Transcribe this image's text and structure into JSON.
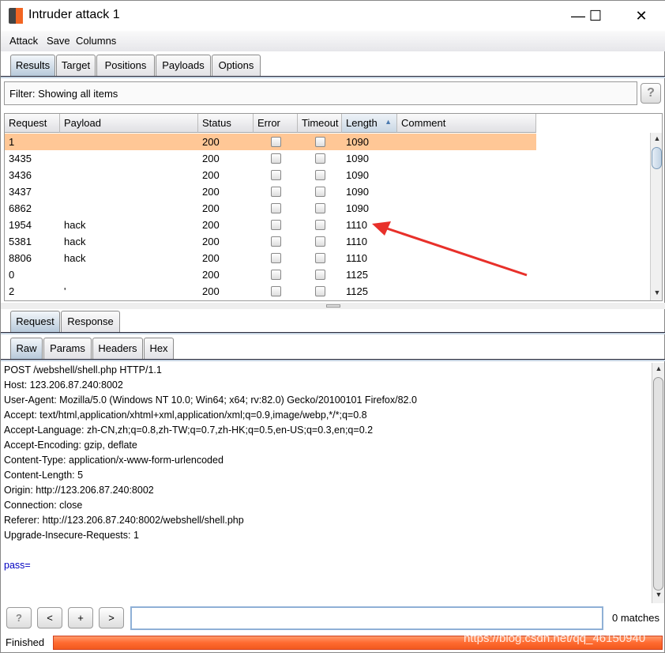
{
  "window": {
    "title": "Intruder attack 1",
    "minimize": "—",
    "maximize": "☐",
    "close": "✕"
  },
  "menu": [
    "Attack",
    "Save",
    "Columns"
  ],
  "tabs": [
    "Results",
    "Target",
    "Positions",
    "Payloads",
    "Options"
  ],
  "filter": {
    "text": "Filter: Showing all items",
    "help": "?"
  },
  "table": {
    "columns": [
      "Request",
      "Payload",
      "Status",
      "Error",
      "Timeout",
      "Length",
      "Comment"
    ],
    "sort_indicator": "▲",
    "rows": [
      {
        "request": "1",
        "payload": "",
        "status": "200",
        "length": "1090",
        "selected": true
      },
      {
        "request": "3435",
        "payload": "",
        "status": "200",
        "length": "1090"
      },
      {
        "request": "3436",
        "payload": "",
        "status": "200",
        "length": "1090"
      },
      {
        "request": "3437",
        "payload": "",
        "status": "200",
        "length": "1090"
      },
      {
        "request": "6862",
        "payload": "",
        "status": "200",
        "length": "1090"
      },
      {
        "request": "1954",
        "payload": "hack",
        "status": "200",
        "length": "1110"
      },
      {
        "request": "5381",
        "payload": "hack",
        "status": "200",
        "length": "1110"
      },
      {
        "request": "8806",
        "payload": "hack",
        "status": "200",
        "length": "1110"
      },
      {
        "request": "0",
        "payload": "",
        "status": "200",
        "length": "1125"
      },
      {
        "request": "2",
        "payload": "'",
        "status": "200",
        "length": "1125"
      }
    ]
  },
  "annotation_color": "#e8302a",
  "message_tabs": [
    "Request",
    "Response"
  ],
  "view_tabs": [
    "Raw",
    "Params",
    "Headers",
    "Hex"
  ],
  "raw": {
    "lines": [
      "POST /webshell/shell.php HTTP/1.1",
      "Host: 123.206.87.240:8002",
      "User-Agent: Mozilla/5.0 (Windows NT 10.0; Win64; x64; rv:82.0) Gecko/20100101 Firefox/82.0",
      "Accept: text/html,application/xhtml+xml,application/xml;q=0.9,image/webp,*/*;q=0.8",
      "Accept-Language: zh-CN,zh;q=0.8,zh-TW;q=0.7,zh-HK;q=0.5,en-US;q=0.3,en;q=0.2",
      "Accept-Encoding: gzip, deflate",
      "Content-Type: application/x-www-form-urlencoded",
      "Content-Length: 5",
      "Origin: http://123.206.87.240:8002",
      "Connection: close",
      "Referer: http://123.206.87.240:8002/webshell/shell.php",
      "Upgrade-Insecure-Requests: 1",
      ""
    ],
    "body": "pass=",
    "body_color": "#0000c0"
  },
  "search": {
    "help": "?",
    "prev": "<",
    "add": "+",
    "next": ">",
    "value": "",
    "matches": "0 matches"
  },
  "status": {
    "text": "Finished",
    "progress": 1.0,
    "progress_color": "#ff6a30"
  },
  "watermark": "https://blog.csdn.net/qq_46150940"
}
